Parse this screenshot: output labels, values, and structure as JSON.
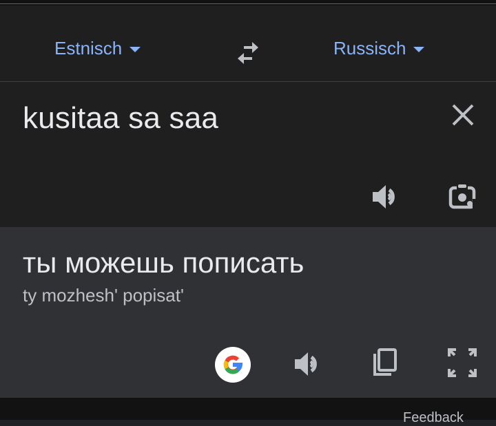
{
  "language_bar": {
    "source_language": "Estnisch",
    "target_language": "Russisch",
    "swap_icon": "swap-arrows-icon"
  },
  "source": {
    "text": "kusitaa sa saa",
    "clear_icon": "close-icon",
    "speak_icon": "speaker-icon",
    "lens_icon": "camera-lens-icon"
  },
  "result": {
    "text": "ты можешь пописать",
    "transliteration": "ty mozhesh' popisat'",
    "google_icon": "google-logo-icon",
    "speak_icon": "speaker-icon",
    "copy_icon": "copy-icon",
    "fullscreen_icon": "fullscreen-icon"
  },
  "footer": {
    "feedback_label": "Feedback"
  },
  "colors": {
    "accent": "#8ab4f8",
    "panel_dark": "#1f1f1f",
    "panel_result": "#303134",
    "icon": "#bdc1c6"
  }
}
